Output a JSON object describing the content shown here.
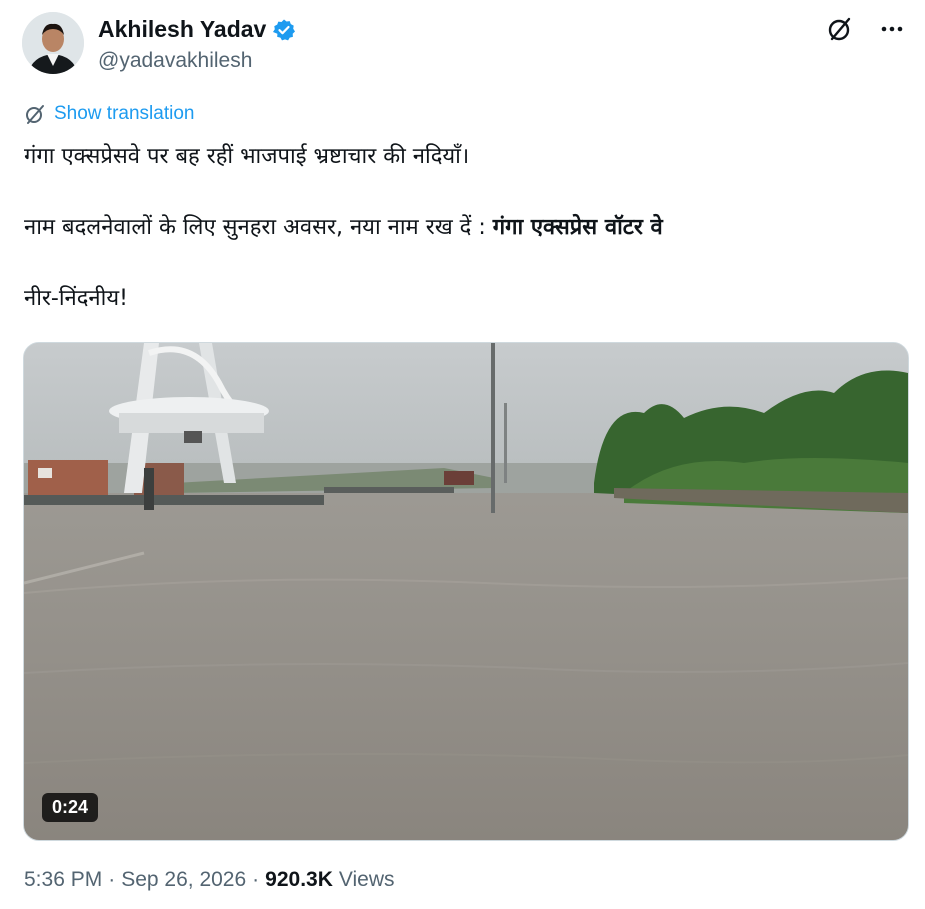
{
  "author": {
    "display_name": "Akhilesh Yadav",
    "handle": "@yadavakhilesh",
    "verified_color": "#1d9bf0"
  },
  "icons": {
    "grok": "grok-icon",
    "more": "more-icon",
    "translate": "translate-icon"
  },
  "translation": {
    "label": "Show translation"
  },
  "tweet": {
    "line1": "गंगा एक्सप्रेसवे पर बह रहीं भाजपाई भ्रष्टाचार की नदियाँ।",
    "line2_prefix": "नाम बदलनेवालों के लिए सुनहरा अवसर, नया नाम रख दें : ",
    "line2_bold": "गंगा एक्सप्रेस वॉटर वे",
    "line3": "नीर-निंदनीय!"
  },
  "media": {
    "duration": "0:24"
  },
  "meta": {
    "time": "5:36 PM",
    "separator1": "·",
    "date": "Sep 26, 2026",
    "separator2": "·",
    "views_count": "920.3K",
    "views_label": "Views"
  },
  "colors": {
    "accent": "#1d9bf0",
    "text": "#0f1419",
    "muted": "#536471"
  }
}
